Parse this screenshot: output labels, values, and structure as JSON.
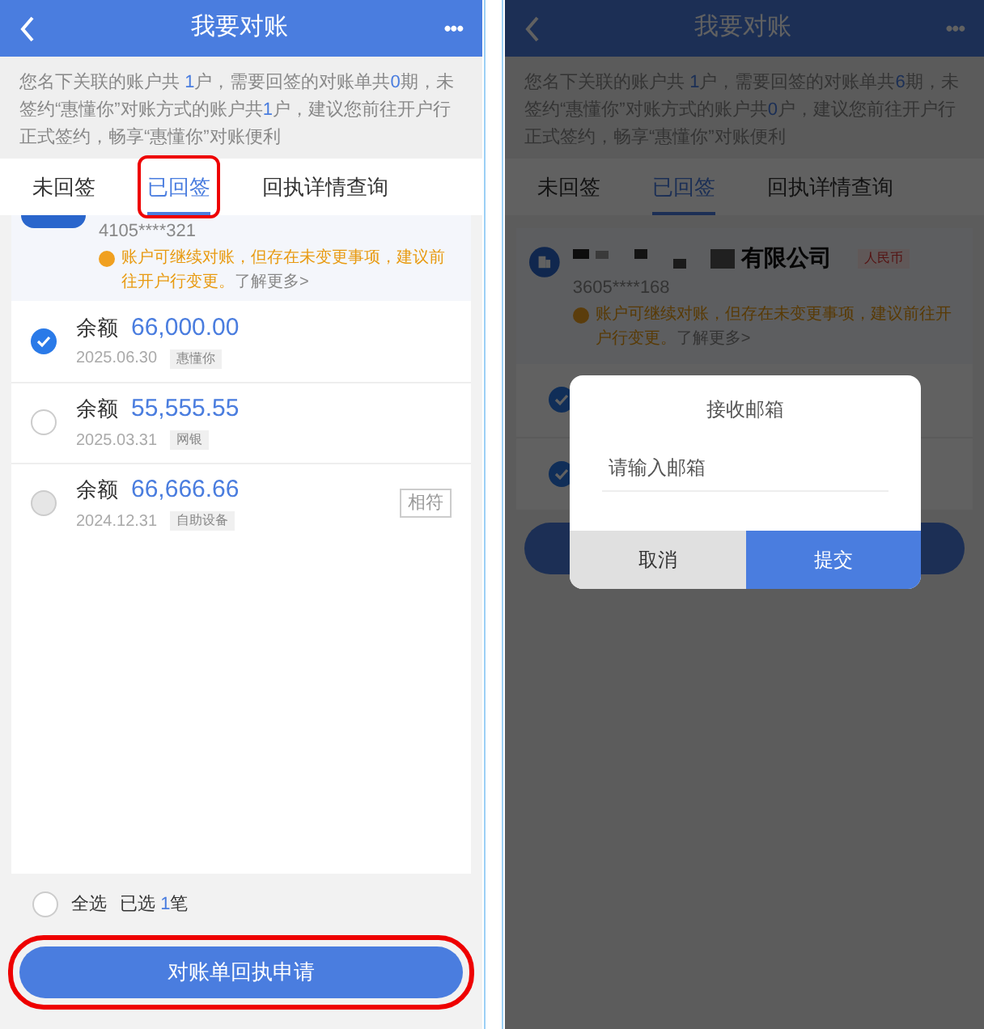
{
  "left": {
    "title": "我要对账",
    "more": "•••",
    "notice": [
      {
        "text": "您名下关联的账户共 ",
        "highlight": false
      },
      {
        "text": "1",
        "highlight": true
      },
      {
        "text": "户，需要回签的对账单共",
        "highlight": false
      },
      {
        "text": "0",
        "highlight": true
      },
      {
        "text": "期，未签约“惠懂你”对账方式的账户共",
        "highlight": false
      },
      {
        "text": "1",
        "highlight": true
      },
      {
        "text": "户，建议您前往开户行正式签约，畅享“惠懂你”对账便利",
        "highlight": false
      }
    ],
    "tabs": [
      {
        "label": "未回签",
        "selected": false,
        "annotated": false
      },
      {
        "label": "已回签",
        "selected": true,
        "annotated": true
      },
      {
        "label": "回执详情查询",
        "selected": false,
        "annotated": false
      }
    ],
    "account": {
      "number": "4105****321",
      "warning": "账户可继续对账，但存在未变更事项，建议前往开户行变更。",
      "more": "了解更多>"
    },
    "statements": [
      {
        "label": "余额",
        "amount": "66,000.00",
        "date": "2025.06.30",
        "channel": "惠懂你",
        "selected": true,
        "disabled": false
      },
      {
        "label": "余额",
        "amount": "55,555.55",
        "date": "2025.03.31",
        "channel": "网银",
        "selected": false,
        "disabled": false
      },
      {
        "label": "余额",
        "amount": "66,666.66",
        "date": "2024.12.31",
        "channel": "自助设备",
        "selected": false,
        "disabled": true,
        "badge": "相符"
      }
    ],
    "select_all": {
      "label": "全选",
      "checked": false
    },
    "selected_count": {
      "prefix": "已选",
      "count": "1",
      "suffix": "笔"
    },
    "submit": {
      "label": "对账单回执申请",
      "annotated": true
    }
  },
  "right": {
    "title": "我要对账",
    "more": "•••",
    "notice": [
      {
        "text": "您名下关联的账户共 ",
        "highlight": false
      },
      {
        "text": "1",
        "highlight": true
      },
      {
        "text": "户，需要回签的对账单共",
        "highlight": false
      },
      {
        "text": "6",
        "highlight": true
      },
      {
        "text": "期，未签约“惠懂你”对账方式的账户共",
        "highlight": false
      },
      {
        "text": "0",
        "highlight": true
      },
      {
        "text": "户，建议您前往开户行正式签约，畅享“惠懂你”对账便利",
        "highlight": false
      }
    ],
    "tabs": [
      {
        "label": "未回签",
        "selected": false
      },
      {
        "label": "已回签",
        "selected": true
      },
      {
        "label": "回执详情查询",
        "selected": false
      }
    ],
    "account": {
      "name": "有限公司",
      "currency": "人民币",
      "number": "3605****168",
      "warning": "账户可继续对账，但存在未变更事项，建议前往开户行变更。",
      "more": "了解更多>"
    },
    "statements": [
      {
        "selected": true
      },
      {
        "selected": true
      }
    ],
    "dialog": {
      "title": "接收邮箱",
      "placeholder": "请输入邮箱",
      "cancel": "取消",
      "confirm": "提交"
    }
  }
}
